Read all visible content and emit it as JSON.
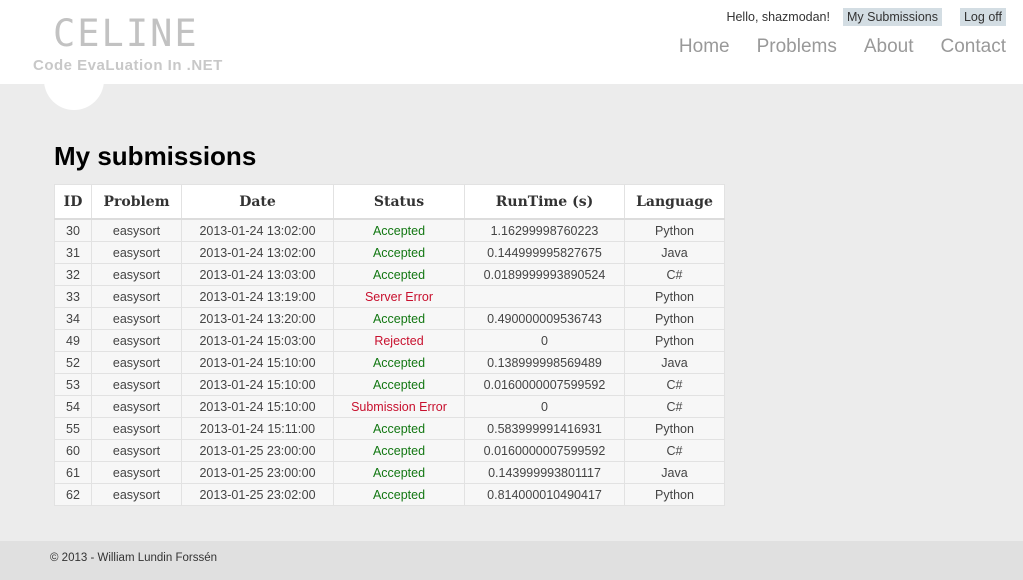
{
  "site": {
    "title": "CELINE",
    "subtitle": "Code EvaLuation In .NET"
  },
  "login": {
    "greeting": "Hello, shazmodan!",
    "my_submissions": "My Submissions",
    "logoff": "Log off"
  },
  "nav": {
    "items": [
      {
        "label": "Home"
      },
      {
        "label": "Problems"
      },
      {
        "label": "About"
      },
      {
        "label": "Contact"
      }
    ]
  },
  "main": {
    "title": "My submissions",
    "columns": [
      "ID",
      "Problem",
      "Date",
      "Status",
      "RunTime (s)",
      "Language"
    ],
    "rows": [
      {
        "id": "30",
        "problem": "easysort",
        "date": "2013-01-24 13:02:00",
        "status": "Accepted",
        "runtime": "1.16299998760223",
        "language": "Python"
      },
      {
        "id": "31",
        "problem": "easysort",
        "date": "2013-01-24 13:02:00",
        "status": "Accepted",
        "runtime": "0.144999995827675",
        "language": "Java"
      },
      {
        "id": "32",
        "problem": "easysort",
        "date": "2013-01-24 13:03:00",
        "status": "Accepted",
        "runtime": "0.0189999993890524",
        "language": "C#"
      },
      {
        "id": "33",
        "problem": "easysort",
        "date": "2013-01-24 13:19:00",
        "status": "Server Error",
        "runtime": "",
        "language": "Python"
      },
      {
        "id": "34",
        "problem": "easysort",
        "date": "2013-01-24 13:20:00",
        "status": "Accepted",
        "runtime": "0.490000009536743",
        "language": "Python"
      },
      {
        "id": "49",
        "problem": "easysort",
        "date": "2013-01-24 15:03:00",
        "status": "Rejected",
        "runtime": "0",
        "language": "Python"
      },
      {
        "id": "52",
        "problem": "easysort",
        "date": "2013-01-24 15:10:00",
        "status": "Accepted",
        "runtime": "0.138999998569489",
        "language": "Java"
      },
      {
        "id": "53",
        "problem": "easysort",
        "date": "2013-01-24 15:10:00",
        "status": "Accepted",
        "runtime": "0.0160000007599592",
        "language": "C#"
      },
      {
        "id": "54",
        "problem": "easysort",
        "date": "2013-01-24 15:10:00",
        "status": "Submission Error",
        "runtime": "0",
        "language": "C#"
      },
      {
        "id": "55",
        "problem": "easysort",
        "date": "2013-01-24 15:11:00",
        "status": "Accepted",
        "runtime": "0.583999991416931",
        "language": "Python"
      },
      {
        "id": "60",
        "problem": "easysort",
        "date": "2013-01-25 23:00:00",
        "status": "Accepted",
        "runtime": "0.0160000007599592",
        "language": "C#"
      },
      {
        "id": "61",
        "problem": "easysort",
        "date": "2013-01-25 23:00:00",
        "status": "Accepted",
        "runtime": "0.143999993801117",
        "language": "Java"
      },
      {
        "id": "62",
        "problem": "easysort",
        "date": "2013-01-25 23:02:00",
        "status": "Accepted",
        "runtime": "0.814000010490417",
        "language": "Python"
      }
    ]
  },
  "footer": {
    "copyright": "© 2013 - William Lundin Forssén"
  },
  "colors": {
    "accepted": "#127712",
    "error": "#c8102e",
    "nav": "#999999",
    "pill": "#d3dde3"
  }
}
